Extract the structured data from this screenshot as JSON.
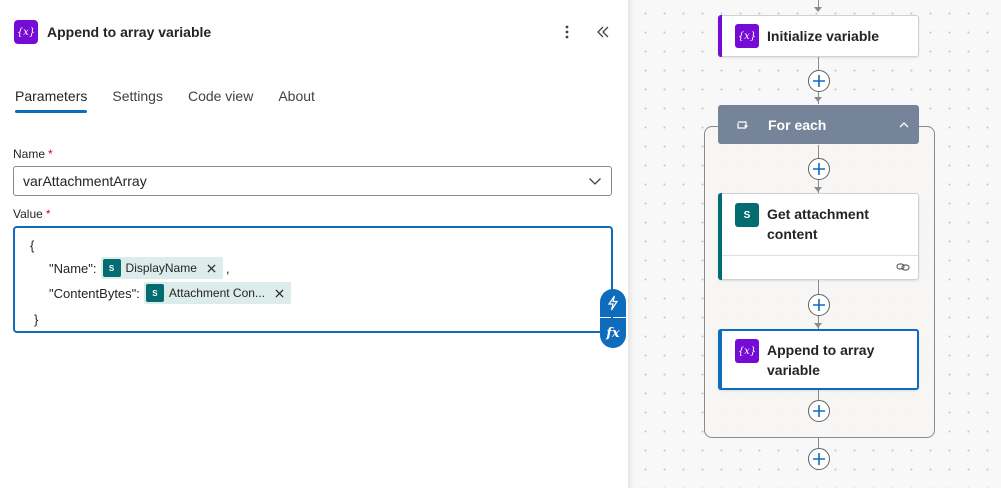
{
  "panel": {
    "title": "Append to array variable",
    "icon_text": "{x}",
    "more_icon": "more-vertical-icon",
    "collapse_icon": "chevron-double-left-icon",
    "tabs": [
      {
        "label": "Parameters",
        "active": true
      },
      {
        "label": "Settings",
        "active": false
      },
      {
        "label": "Code view",
        "active": false
      },
      {
        "label": "About",
        "active": false
      }
    ],
    "name_field": {
      "label": "Name",
      "required_mark": "*",
      "value": "varAttachmentArray"
    },
    "value_field": {
      "label": "Value",
      "required_mark": "*",
      "open_brace": "{",
      "close_brace": "}",
      "line1_key": "\"Name\":",
      "line1_token": "DisplayName",
      "line1_suffix": ",",
      "line2_key": "\"ContentBytes\":",
      "line2_token": "Attachment Con...",
      "token_icon_text": "S"
    },
    "dynamic_content_icon": "lightning-icon",
    "expression_icon_text": "fx"
  },
  "canvas": {
    "cards": {
      "initialize": {
        "title": "Initialize variable",
        "icon_text": "{x}"
      },
      "foreach": {
        "title": "For each"
      },
      "get_attachment": {
        "title_line1": "Get attachment",
        "title_line2": "content",
        "icon_text": "S"
      },
      "append": {
        "title_line1": "Append to array",
        "title_line2": "variable",
        "icon_text": "{x}"
      }
    }
  },
  "colors": {
    "accent_blue": "#0f6cbd",
    "variable_purple": "#770bd6",
    "sharepoint_teal": "#036c70",
    "foreach_header": "#758499",
    "required_red": "#c50f1f"
  }
}
